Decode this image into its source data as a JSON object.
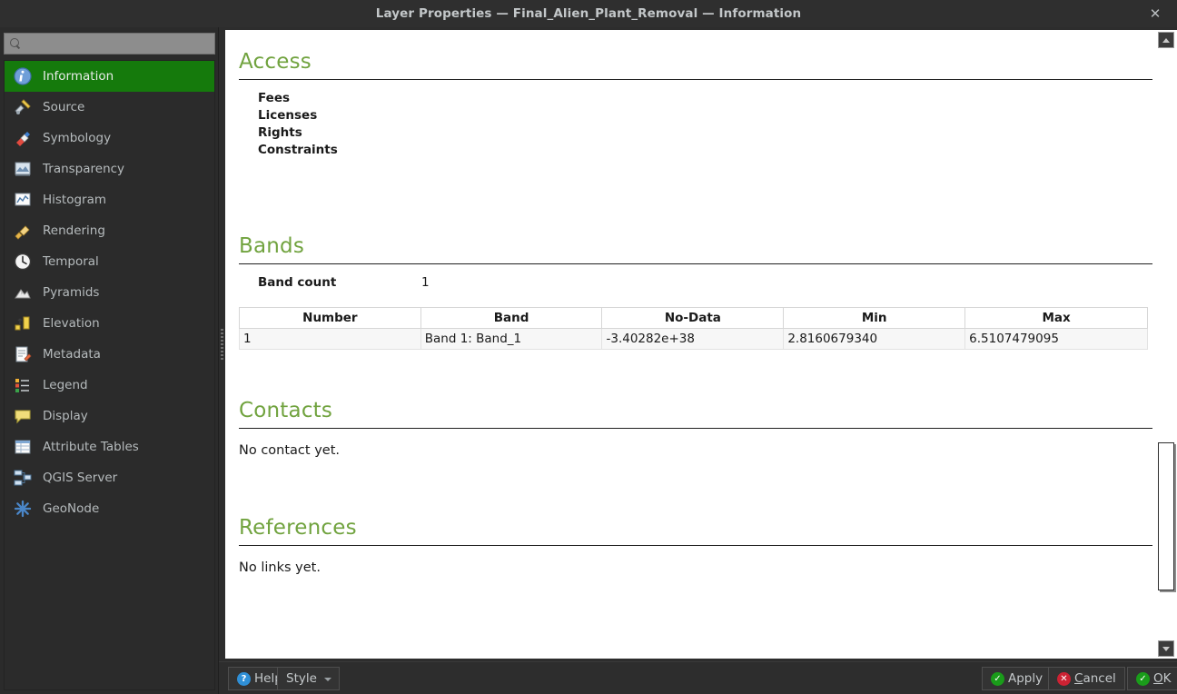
{
  "window": {
    "title": "Layer Properties — Final_Alien_Plant_Removal — Information",
    "close_icon": "close-icon"
  },
  "sidebar": {
    "search": {
      "value": "",
      "placeholder": ""
    },
    "items": [
      {
        "label": "Information",
        "icon": "information-icon",
        "selected": true
      },
      {
        "label": "Source",
        "icon": "source-icon",
        "selected": false
      },
      {
        "label": "Symbology",
        "icon": "symbology-icon",
        "selected": false
      },
      {
        "label": "Transparency",
        "icon": "transparency-icon",
        "selected": false
      },
      {
        "label": "Histogram",
        "icon": "histogram-icon",
        "selected": false
      },
      {
        "label": "Rendering",
        "icon": "rendering-icon",
        "selected": false
      },
      {
        "label": "Temporal",
        "icon": "temporal-clock-icon",
        "selected": false
      },
      {
        "label": "Pyramids",
        "icon": "pyramids-icon",
        "selected": false
      },
      {
        "label": "Elevation",
        "icon": "elevation-icon",
        "selected": false
      },
      {
        "label": "Metadata",
        "icon": "metadata-icon",
        "selected": false
      },
      {
        "label": "Legend",
        "icon": "legend-icon",
        "selected": false
      },
      {
        "label": "Display",
        "icon": "display-balloon-icon",
        "selected": false
      },
      {
        "label": "Attribute Tables",
        "icon": "attribute-tables-icon",
        "selected": false
      },
      {
        "label": "QGIS Server",
        "icon": "qgis-server-icon",
        "selected": false
      },
      {
        "label": "GeoNode",
        "icon": "geonode-icon",
        "selected": false
      }
    ]
  },
  "content": {
    "access": {
      "heading": "Access",
      "rows": [
        "Fees",
        "Licenses",
        "Rights",
        "Constraints"
      ]
    },
    "bands": {
      "heading": "Bands",
      "band_count_label": "Band count",
      "band_count_value": "1",
      "columns": [
        "Number",
        "Band",
        "No-Data",
        "Min",
        "Max"
      ],
      "rows": [
        [
          "1",
          "Band 1: Band_1",
          "-3.40282e+38",
          "2.8160679340",
          "6.5107479095"
        ]
      ]
    },
    "contacts": {
      "heading": "Contacts",
      "text": "No contact yet."
    },
    "references": {
      "heading": "References",
      "text": "No links yet."
    }
  },
  "scrollbar": {
    "up_icon": "scroll-up-arrow-icon",
    "down_icon": "scroll-down-arrow-icon"
  },
  "buttons": {
    "help": {
      "label": "Help",
      "icon": "help-icon"
    },
    "style": {
      "label": "Style",
      "icon": "chevron-down-icon"
    },
    "apply": {
      "label": "Apply",
      "icon": "check-circle-icon"
    },
    "cancel": {
      "mnemonic": "C",
      "rest": "ancel",
      "icon": "cancel-circle-icon"
    },
    "ok": {
      "mnemonic": "O",
      "rest": "K",
      "icon": "check-circle-icon"
    }
  },
  "colors": {
    "heading_green": "#71a33f",
    "selected_green": "#157a0c",
    "accent_blue": "#2f8fd6",
    "danger_red": "#cc2233",
    "success_green": "#1a9c1a"
  }
}
